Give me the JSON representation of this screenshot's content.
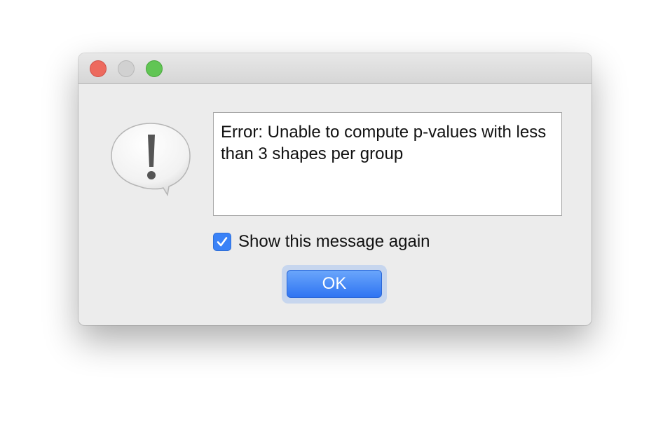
{
  "window": {
    "controls": {
      "close": "close",
      "minimize": "minimize",
      "zoom": "zoom"
    }
  },
  "alert": {
    "icon": "exclamation-speech-bubble-icon",
    "message": "Error: Unable to compute p-values with less than 3 shapes per group"
  },
  "checkbox": {
    "label": "Show this message again",
    "checked": true
  },
  "buttons": {
    "ok_label": "OK"
  },
  "colors": {
    "accent": "#3a82f7",
    "close": "#ed6a5e",
    "minimize": "#d1d1d1",
    "zoom": "#61c554"
  }
}
